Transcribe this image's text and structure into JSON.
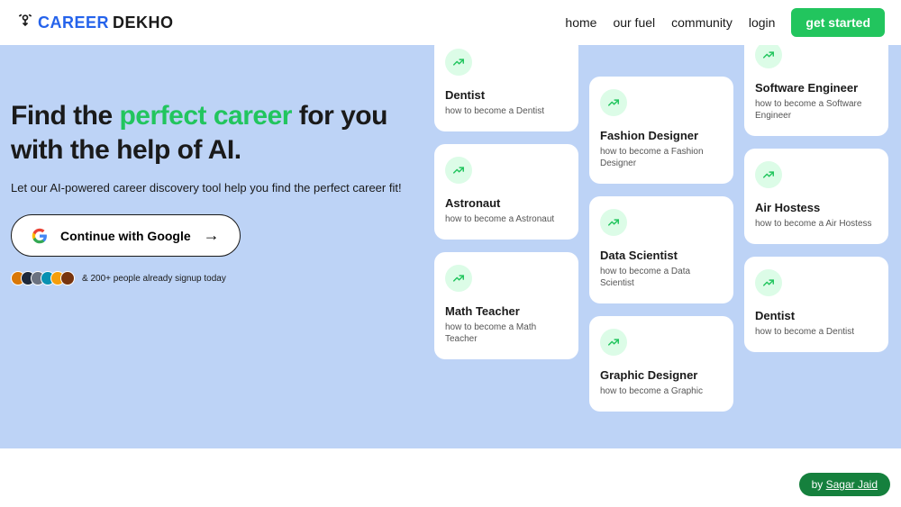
{
  "brand": {
    "part1": "CAREER",
    "part2": "DEKHO"
  },
  "nav": {
    "home": "home",
    "fuel": "our fuel",
    "community": "community",
    "login": "login",
    "cta": "get started"
  },
  "hero": {
    "h1a": "Find the ",
    "h1b": "perfect career",
    "h1c": " for you with the help of AI.",
    "sub": "Let our AI-powered career discovery tool help you find the perfect career fit!",
    "google": "Continue with Google",
    "social": "& 200+ people already signup today"
  },
  "cards": {
    "c0": {
      "title": "Dentist",
      "sub": "how to become a Dentist"
    },
    "c1": {
      "title": "Astronaut",
      "sub": "how to become a Astronaut"
    },
    "c2": {
      "title": "Math Teacher",
      "sub": "how to become a Math Teacher"
    },
    "c3": {
      "title": "Fashion Designer",
      "sub": "how to become a Fashion Designer"
    },
    "c4": {
      "title": "Data Scientist",
      "sub": "how to become a Data Scientist"
    },
    "c5": {
      "title": "Graphic Designer",
      "sub": "how to become a Graphic"
    },
    "c6": {
      "title": "Software Engineer",
      "sub": "how to become a Software Engineer"
    },
    "c7": {
      "title": "Air Hostess",
      "sub": "how to become a Air Hostess"
    },
    "c8": {
      "title": "Dentist",
      "sub": "how to become a Dentist"
    }
  },
  "credit": {
    "by": "by ",
    "name": "Sagar Jaid"
  },
  "colors": {
    "avatars": [
      "#d97706",
      "#1e293b",
      "#6b7280",
      "#0891b2",
      "#f59e0b",
      "#78350f"
    ]
  }
}
